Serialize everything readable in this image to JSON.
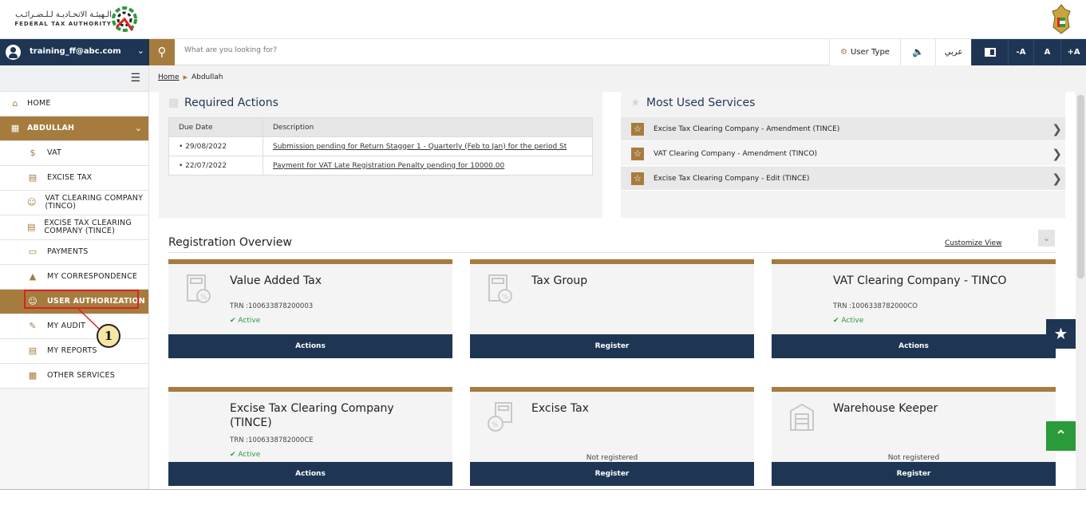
{
  "header": {
    "logo_ar": "الـهيئـة الاتحـاديـة لـلـضـرائـب",
    "logo_en": "FEDERAL TAX AUTHORITY"
  },
  "toolbar": {
    "user": "training_ff@abc.com",
    "search_placeholder": "What are you looking for?",
    "user_type": "User Type",
    "arabic": "عربي",
    "font_smaller": "-A",
    "font_normal": "A",
    "font_larger": "+A"
  },
  "sidebar": {
    "items": [
      {
        "label": "HOME",
        "icon": "home-icon"
      },
      {
        "label": "ABDULLAH",
        "icon": "grid-icon"
      },
      {
        "label": "VAT",
        "icon": "vat-icon"
      },
      {
        "label": "EXCISE TAX",
        "icon": "excise-icon"
      },
      {
        "label": "VAT CLEARING COMPANY (TINCO)",
        "icon": "user-icon"
      },
      {
        "label": "EXCISE TAX CLEARING COMPANY (TINCE)",
        "icon": "document-icon"
      },
      {
        "label": "PAYMENTS",
        "icon": "card-icon"
      },
      {
        "label": "MY CORRESPONDENCE",
        "icon": "building-icon"
      },
      {
        "label": "USER AUTHORIZATION",
        "icon": "user-key-icon"
      },
      {
        "label": "MY AUDIT",
        "icon": "audit-icon"
      },
      {
        "label": "MY REPORTS",
        "icon": "report-icon"
      },
      {
        "label": "OTHER SERVICES",
        "icon": "clipboard-icon"
      }
    ],
    "callout_number": "1"
  },
  "breadcrumb": {
    "home": "Home",
    "current": "Abdullah"
  },
  "required_actions": {
    "title": "Required Actions",
    "columns": [
      "Due Date",
      "Description"
    ],
    "rows": [
      {
        "date": "• 29/08/2022",
        "desc": "Submission pending for Return Stagger 1 - Quarterly (Feb to Jan) for the period St"
      },
      {
        "date": "• 22/07/2022",
        "desc": "Payment for VAT Late Registration Penalty pending for 10000.00"
      }
    ]
  },
  "most_used": {
    "title": "Most Used Services",
    "items": [
      "Excise Tax Clearing Company - Amendment (TINCE)",
      "VAT Clearing Company - Amendment (TINCO)",
      "Excise Tax Clearing Company - Edit (TINCE)"
    ]
  },
  "registration": {
    "title": "Registration Overview",
    "customize": "Customize View",
    "cards": [
      {
        "title": "Value Added Tax",
        "trn": "TRN :100633878200003",
        "status": "Active",
        "button": "Actions"
      },
      {
        "title": "Tax Group",
        "button": "Register"
      },
      {
        "title": "VAT Clearing Company - TINCO",
        "trn": "TRN :1006338782000CO",
        "status": "Active",
        "button": "Actions"
      },
      {
        "title": "Excise Tax Clearing Company (TINCE)",
        "trn": "TRN :1006338782000CE",
        "status": "Active",
        "button": "Actions"
      },
      {
        "title": "Excise Tax",
        "status": "Not registered",
        "button": "Register"
      },
      {
        "title": "Warehouse Keeper",
        "status": "Not registered",
        "button": "Register"
      }
    ]
  },
  "colors": {
    "navy": "#1e3653",
    "gold": "#a67c3e",
    "green": "#2a9a3a"
  }
}
